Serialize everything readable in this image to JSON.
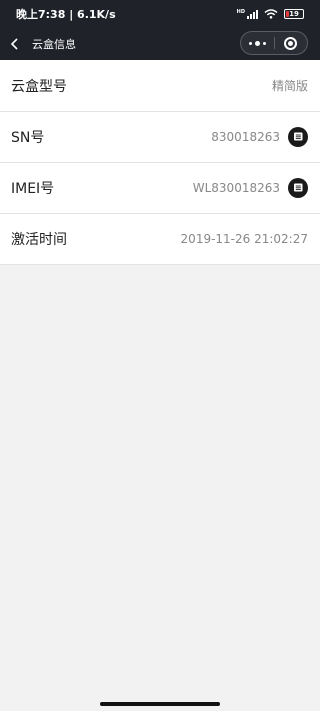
{
  "status_bar": {
    "time_speed": "晚上7:38 | 6.1K/s",
    "network_label": "HD",
    "battery_level": "19",
    "battery_color": "#e5393a"
  },
  "nav": {
    "title": "云盒信息",
    "back_icon": "chevron-left-icon",
    "menu_icon": "more-dots-icon",
    "close_icon": "target-circle-icon"
  },
  "rows": [
    {
      "label": "云盒型号",
      "value": "精简版",
      "copy": false
    },
    {
      "label": "SN号",
      "value": "830018263",
      "copy": true
    },
    {
      "label": "IMEI号",
      "value": "WL830018263",
      "copy": true
    },
    {
      "label": "激活时间",
      "value": "2019-11-26 21:02:27",
      "copy": false
    }
  ]
}
